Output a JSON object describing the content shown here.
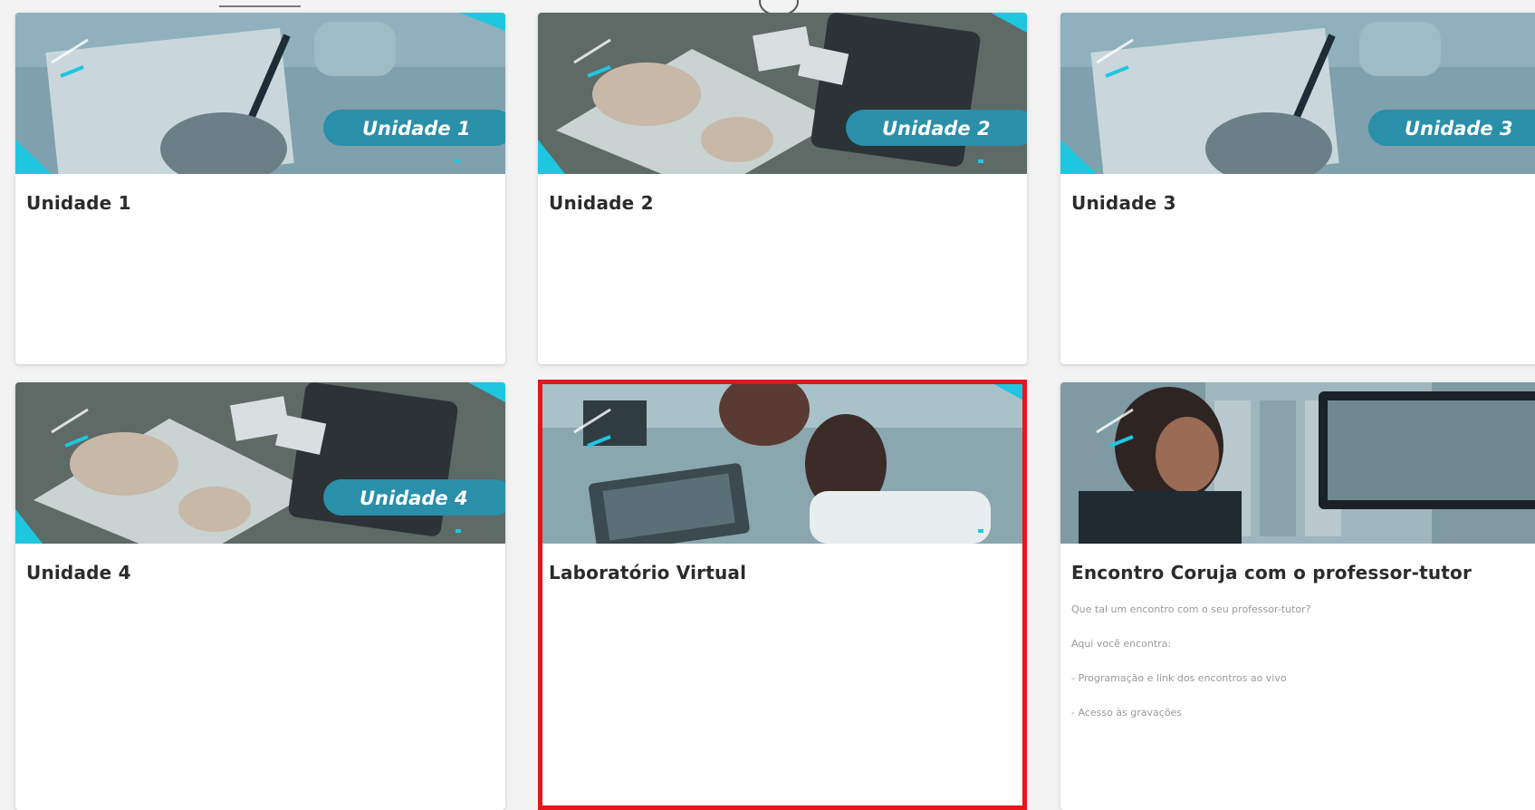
{
  "cards": [
    {
      "title": "Unidade 1",
      "badge": "Unidade 1",
      "photo": "desk-writing"
    },
    {
      "title": "Unidade 2",
      "badge": "Unidade 2",
      "photo": "tablet-notebook"
    },
    {
      "title": "Unidade 3",
      "badge": "Unidade 3",
      "photo": "desk-writing"
    },
    {
      "title": "Unidade 4",
      "badge": "Unidade 4",
      "photo": "tablet-notebook"
    },
    {
      "title": "Laboratório Virtual",
      "badge": "",
      "photo": "student-laptop",
      "highlighted": true
    },
    {
      "title": "Encontro Coruja com o professor-tutor",
      "badge": "",
      "photo": "video-call",
      "description": [
        "Que tal um encontro com o seu professor-tutor?",
        "Aqui você encontra:",
        "- Programação e link dos encontros ao vivo",
        "- Acesso às gravações"
      ]
    }
  ],
  "colors": {
    "accent": "#1fc6e0",
    "overlay": "#2a8fa8",
    "highlight_border": "#e3151d",
    "title": "#2b2b2b"
  }
}
